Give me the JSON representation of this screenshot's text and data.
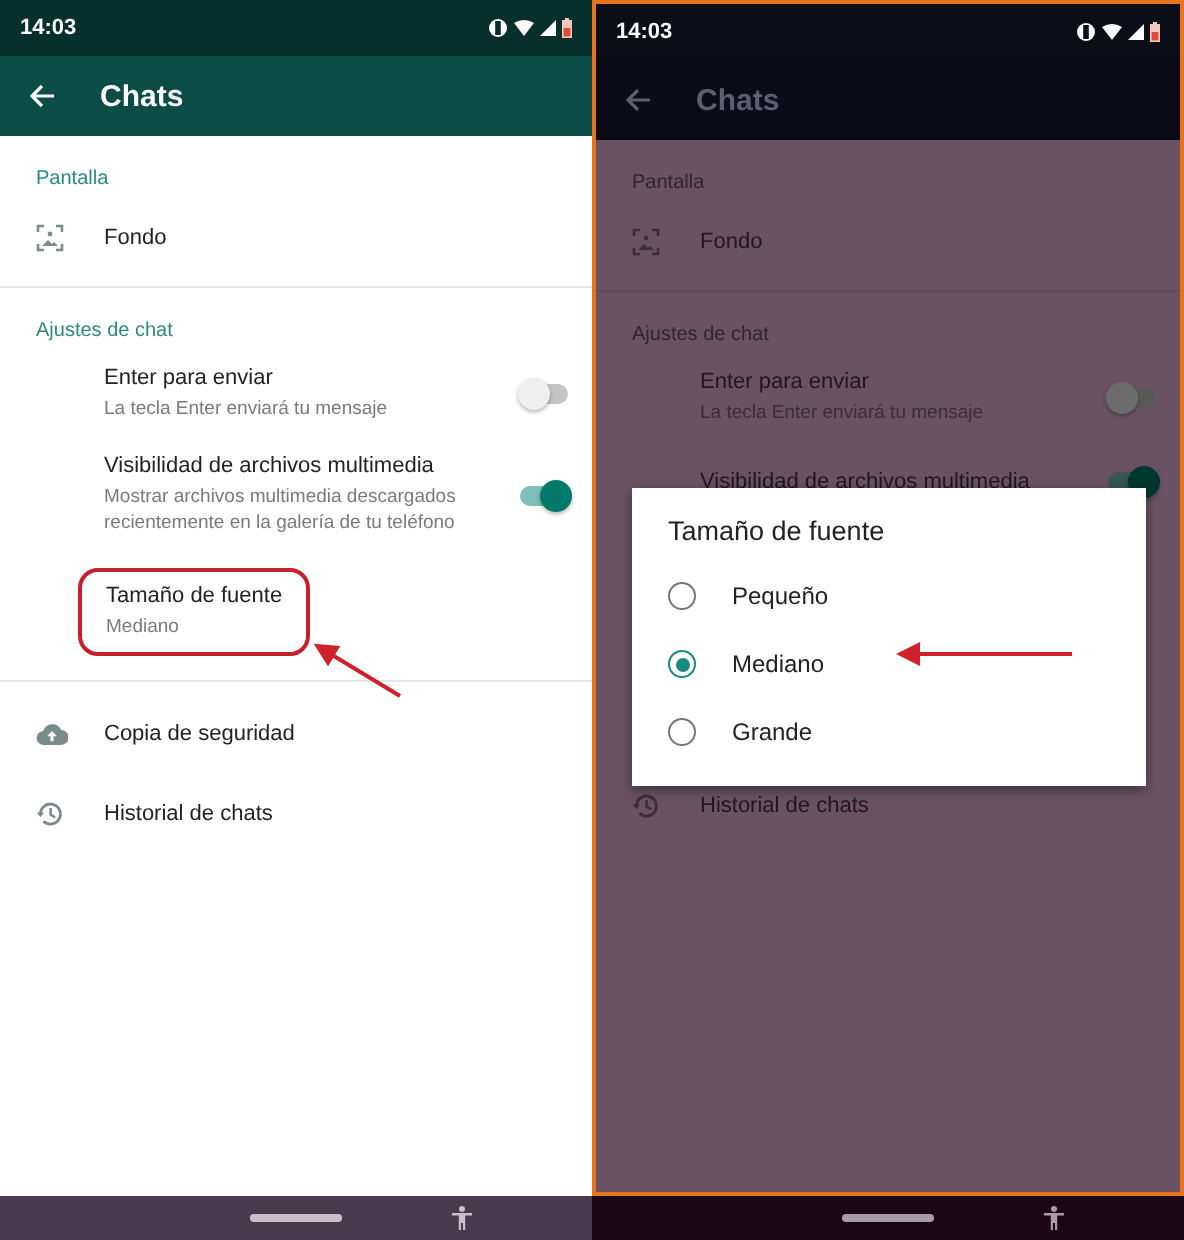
{
  "screens": [
    {
      "dimmed": false,
      "status_bar": {
        "time": "14:03"
      },
      "app_bar": {
        "title": "Chats"
      },
      "sections": [
        {
          "header": "Pantalla",
          "items": [
            {
              "kind": "wallpaper",
              "title": "Fondo"
            }
          ]
        },
        {
          "header": "Ajustes de chat",
          "items": [
            {
              "kind": "toggle",
              "title": "Enter para enviar",
              "subtitle": "La tecla Enter enviará tu mensaje",
              "on": false
            },
            {
              "kind": "toggle",
              "title": "Visibilidad de archivos multimedia",
              "subtitle": "Mostrar archivos multimedia descargados recientemente en la galería de tu teléfono",
              "on": true
            },
            {
              "kind": "value",
              "title": "Tamaño de fuente",
              "subtitle": "Mediano",
              "highlighted": true
            }
          ]
        },
        {
          "items": [
            {
              "kind": "backup",
              "title": "Copia de seguridad"
            },
            {
              "kind": "history",
              "title": "Historial de chats"
            }
          ]
        }
      ]
    },
    {
      "dimmed": true,
      "status_bar": {
        "time": "14:03"
      },
      "app_bar": {
        "title": "Chats"
      },
      "sections": [
        {
          "header": "Pantalla",
          "items": [
            {
              "kind": "wallpaper",
              "title": "Fondo"
            }
          ]
        },
        {
          "header": "Ajustes de chat",
          "items": [
            {
              "kind": "toggle",
              "title": "Enter para enviar",
              "subtitle": "La tecla Enter enviará tu mensaje",
              "on": false
            },
            {
              "kind": "toggle",
              "title": "Visibilidad de archivos multimedia",
              "on": true
            },
            {
              "kind": "covered"
            },
            {
              "kind": "history",
              "title": "Historial de chats"
            }
          ]
        }
      ],
      "dialog": {
        "title": "Tamaño de fuente",
        "options": [
          {
            "label": "Pequeño",
            "selected": false
          },
          {
            "label": "Mediano",
            "selected": true
          },
          {
            "label": "Grande",
            "selected": false
          }
        ]
      }
    }
  ]
}
